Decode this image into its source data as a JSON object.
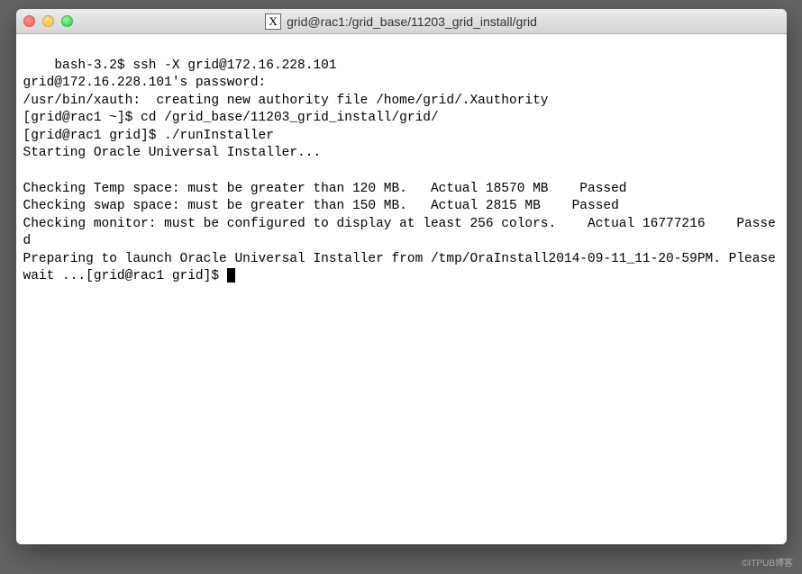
{
  "window": {
    "title": "grid@rac1:/grid_base/11203_grid_install/grid",
    "app_icon_label": "X"
  },
  "terminal": {
    "lines": [
      "bash-3.2$ ssh -X grid@172.16.228.101",
      "grid@172.16.228.101's password:",
      "/usr/bin/xauth:  creating new authority file /home/grid/.Xauthority",
      "[grid@rac1 ~]$ cd /grid_base/11203_grid_install/grid/",
      "[grid@rac1 grid]$ ./runInstaller",
      "Starting Oracle Universal Installer...",
      "",
      "Checking Temp space: must be greater than 120 MB.   Actual 18570 MB    Passed",
      "Checking swap space: must be greater than 150 MB.   Actual 2815 MB    Passed",
      "Checking monitor: must be configured to display at least 256 colors.    Actual 16777216    Passed",
      "Preparing to launch Oracle Universal Installer from /tmp/OraInstall2014-09-11_11-20-59PM. Please wait ...[grid@rac1 grid]$ "
    ]
  },
  "watermark": "©ITPUB博客"
}
